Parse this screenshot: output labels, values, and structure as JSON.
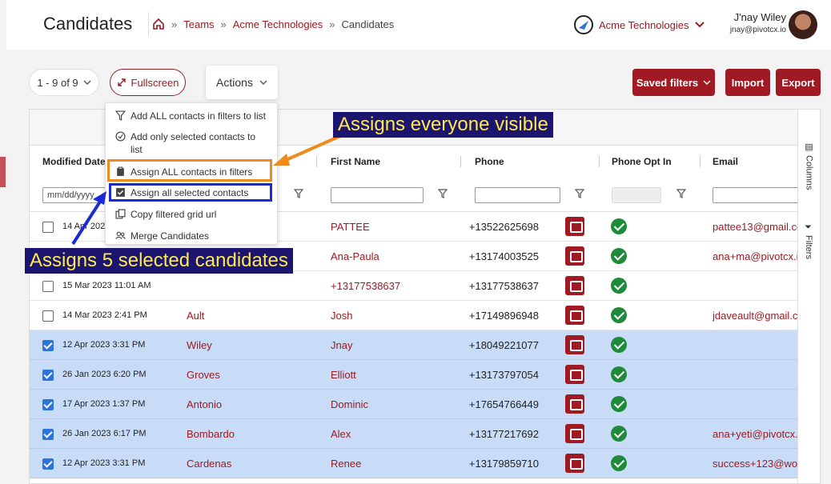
{
  "header": {
    "title": "Candidates",
    "breadcrumbs": [
      "Teams",
      "Acme Technologies",
      "Candidates"
    ],
    "org_name": "Acme Technologies",
    "user_name": "J'nay Wiley",
    "user_email": "jnay@pivotcx.io"
  },
  "toolbar": {
    "pager": "1 - 9 of 9",
    "fullscreen": "Fullscreen",
    "actions": "Actions",
    "saved_filters": "Saved filters",
    "import": "Import",
    "export": "Export"
  },
  "actions_menu": {
    "items": [
      {
        "label": "Add ALL contacts in filters to list",
        "icon": "filter-icon"
      },
      {
        "label": "Add only selected contacts to list",
        "icon": "check-circle-icon"
      },
      {
        "label": "Assign ALL contacts in filters",
        "icon": "clipboard-icon"
      },
      {
        "label": "Assign all selected contacts",
        "icon": "checked-square-icon"
      },
      {
        "label": "Copy filtered grid url",
        "icon": "copy-icon"
      },
      {
        "label": "Merge Candidates",
        "icon": "users-icon"
      }
    ]
  },
  "annotations": {
    "orange_note": "Assigns everyone visible",
    "blue_note": "Assigns 5 selected candidates"
  },
  "grid": {
    "columns": [
      "Modified Date",
      "First Name",
      "Phone",
      "Phone Opt In",
      "Email"
    ],
    "date_placeholder": "mm/dd/yyyy",
    "side_columns": "Columns",
    "side_filters": "Filters",
    "rows": [
      {
        "selected": false,
        "date": "14 Apr 2023",
        "last": "",
        "first": "PATTEE",
        "phone": "+13522625698",
        "opt_in": true,
        "email": "pattee13@gmail.co"
      },
      {
        "selected": false,
        "date": "",
        "last": "",
        "first": "Ana-Paula",
        "phone": "+13174003525",
        "opt_in": true,
        "email": "ana+ma@pivotcx.i"
      },
      {
        "selected": false,
        "date": "15 Mar 2023 11:01 AM",
        "last": "",
        "first": "+13177538637",
        "phone": "+13177538637",
        "opt_in": true,
        "email": ""
      },
      {
        "selected": false,
        "date": "14 Mar 2023 2:41 PM",
        "last": "Ault",
        "first": "Josh",
        "phone": "+17149896948",
        "opt_in": true,
        "email": "jdaveault@gmail.co"
      },
      {
        "selected": true,
        "date": "12 Apr 2023 3:31 PM",
        "last": "Wiley",
        "first": "Jnay",
        "phone": "+18049221077",
        "opt_in": true,
        "email": ""
      },
      {
        "selected": true,
        "date": "26 Jan 2023 6:20 PM",
        "last": "Groves",
        "first": "Elliott",
        "phone": "+13173797054",
        "opt_in": true,
        "email": ""
      },
      {
        "selected": true,
        "date": "17 Apr 2023 1:37 PM",
        "last": "Antonio",
        "first": "Dominic",
        "phone": "+17654766449",
        "opt_in": true,
        "email": ""
      },
      {
        "selected": true,
        "date": "26 Jan 2023 6:17 PM",
        "last": "Bombardo",
        "first": "Alex",
        "phone": "+13177217692",
        "opt_in": true,
        "email": "ana+yeti@pivotcx."
      },
      {
        "selected": true,
        "date": "12 Apr 2023 3:31 PM",
        "last": "Cardenas",
        "first": "Renee",
        "phone": "+13179859710",
        "opt_in": true,
        "email": "success+123@wo"
      }
    ]
  },
  "colors": {
    "brand": "#a01a24",
    "selected_row": "#c8dcf7",
    "note_bg": "#1c1570",
    "note_text": "#ffe94a",
    "highlight_orange": "#f08a1e",
    "highlight_blue": "#1a2ad8"
  }
}
